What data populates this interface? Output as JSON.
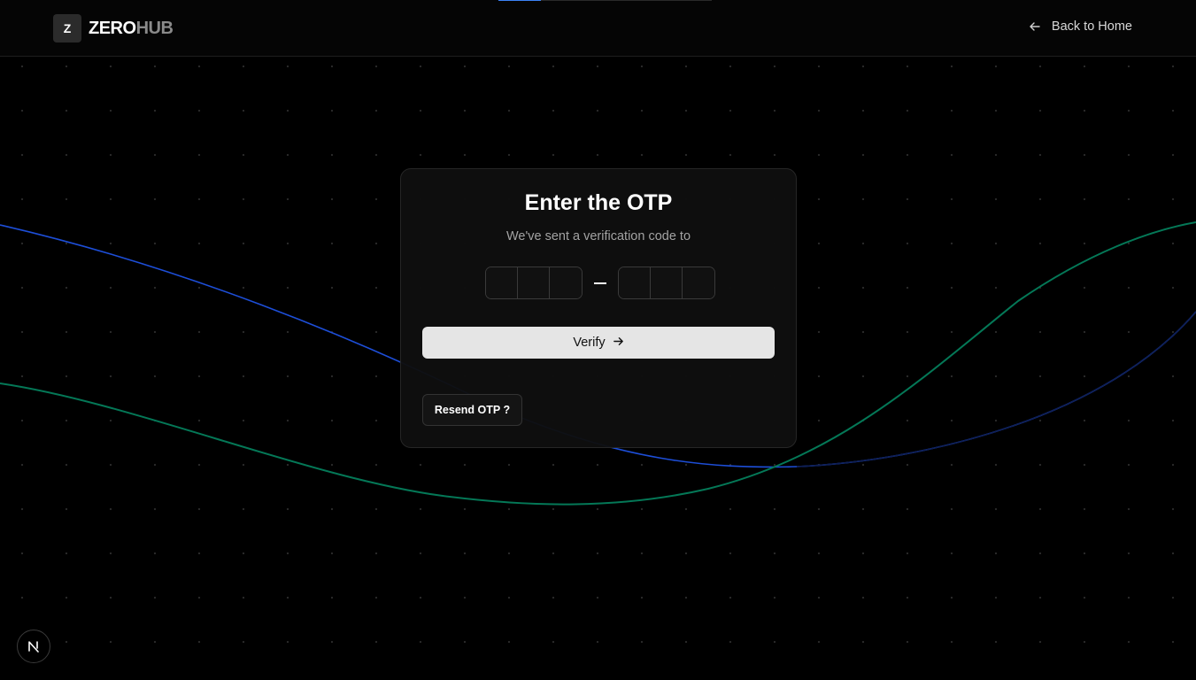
{
  "header": {
    "logo_mark": "Z",
    "logo_primary": "ZERO",
    "logo_secondary": "HUB",
    "back_label": "Back to Home",
    "progress": 0.2
  },
  "card": {
    "title": "Enter the OTP",
    "subtitle": "We've sent a verification code to",
    "otp_groups": [
      {
        "slots": [
          "",
          "",
          ""
        ]
      },
      {
        "slots": [
          "",
          "",
          ""
        ]
      }
    ],
    "verify_label": "Verify",
    "resend_label": "Resend OTP ?"
  },
  "colors": {
    "background": "#000000",
    "accent_blue": "#1d4ed8",
    "accent_green": "#047857",
    "button_light": "#e5e5e5"
  },
  "icons": {
    "back": "arrow-left-icon",
    "verify": "arrow-right-icon",
    "badge": "nextjs-n-icon"
  }
}
